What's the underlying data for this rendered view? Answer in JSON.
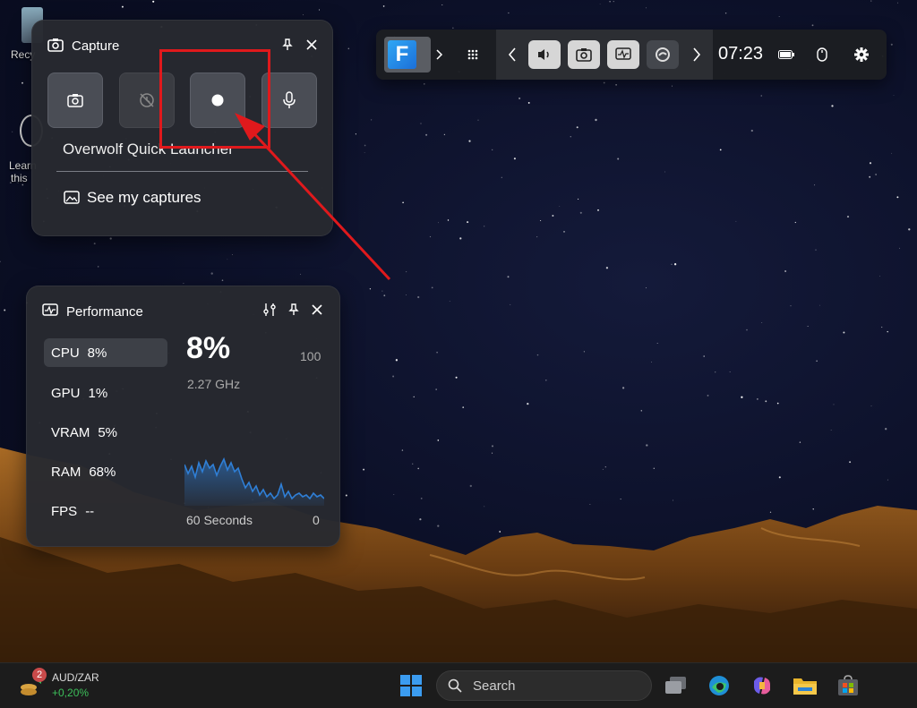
{
  "capture_panel": {
    "title": "Capture",
    "launcher_label": "Overwolf Quick Launcher",
    "see_captures_label": "See my captures"
  },
  "performance_panel": {
    "title": "Performance",
    "metrics": [
      {
        "name": "CPU",
        "value": "8%"
      },
      {
        "name": "GPU",
        "value": "1%"
      },
      {
        "name": "VRAM",
        "value": "5%"
      },
      {
        "name": "RAM",
        "value": "68%"
      },
      {
        "name": "FPS",
        "value": "--"
      }
    ],
    "current_value": "8%",
    "max_value": "100",
    "frequency": "2.27 GHz",
    "axis_left": "60 Seconds",
    "axis_right": "0"
  },
  "gamebar": {
    "clock": "07:23",
    "app_letter": "F"
  },
  "desktop": {
    "icon1_label": "Recy",
    "icon2_label_line1": "Learn",
    "icon2_label_line2": "this"
  },
  "taskbar": {
    "widget_title": "AUD/ZAR",
    "widget_change": "+0,20%",
    "widget_badge": "2",
    "search_placeholder": "Search"
  },
  "colors": {
    "highlight": "#e0191c",
    "graph": "#2f7fd6",
    "widget_positive": "#3cbf5a"
  }
}
